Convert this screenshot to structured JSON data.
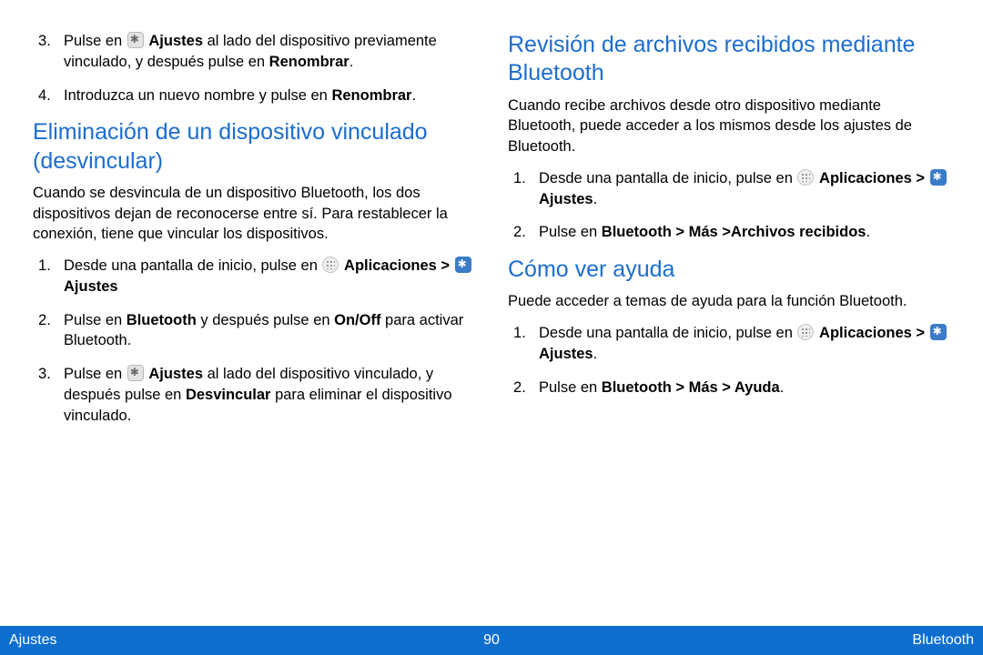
{
  "left": {
    "list1": {
      "item3": {
        "t1": "Pulse en ",
        "gear_alt": "icono-ajustes-gris",
        "t2": " ",
        "b1": "Ajustes",
        "t3": " al lado del dispositivo previamente vinculado, y después pulse en ",
        "b2": "Renombrar",
        "t4": "."
      },
      "item4": {
        "t1": "Introduzca un nuevo nombre y pulse en ",
        "b1": "Renombrar",
        "t2": "."
      }
    },
    "heading1": "Eliminación de un dispositivo vinculado (desvincular)",
    "para1": "Cuando se desvincula de un dispositivo Bluetooth, los dos dispositivos dejan de reconocerse entre sí. Para restablecer la conexión, tiene que vincular los dispositivos.",
    "list2": {
      "item1": {
        "t1": "Desde una pantalla de inicio, pulse en ",
        "apps_alt": "icono-aplicaciones",
        "t2": " ",
        "b1": "Aplicaciones > ",
        "gear_alt": "icono-ajustes",
        "t3": " ",
        "b2": "Ajustes"
      },
      "item2": {
        "t1": "Pulse en ",
        "b1": "Bluetooth",
        "t2": " y después pulse en ",
        "b2": "On/Off",
        "t3": " para activar Bluetooth."
      },
      "item3": {
        "t1": "Pulse en ",
        "gear_alt": "icono-ajustes-gris",
        "t2": " ",
        "b1": "Ajustes",
        "t3": " al lado del dispositivo vinculado, y después pulse en ",
        "b2": "Desvincular",
        "t4": " para eliminar el dispositivo vinculado."
      }
    }
  },
  "right": {
    "heading1": "Revisión de archivos recibidos mediante Bluetooth",
    "para1": "Cuando recibe archivos desde otro dispositivo mediante Bluetooth, puede acceder a los mismos desde los ajustes de Bluetooth.",
    "list1": {
      "item1": {
        "t1": "Desde una pantalla de inicio, pulse en ",
        "apps_alt": "icono-aplicaciones",
        "t2": " ",
        "b1": "Aplicaciones > ",
        "gear_alt": "icono-ajustes",
        "t3": " ",
        "b2": "Ajustes",
        "t4": "."
      },
      "item2": {
        "t1": "Pulse en ",
        "b1": "Bluetooth > Más >Archivos recibidos",
        "t2": "."
      }
    },
    "heading2": "Cómo ver ayuda",
    "para2": "Puede acceder a temas de ayuda para la función Bluetooth.",
    "list2": {
      "item1": {
        "t1": "Desde una pantalla de inicio, pulse en ",
        "apps_alt": "icono-aplicaciones",
        "t2": " ",
        "b1": "Aplicaciones > ",
        "gear_alt": "icono-ajustes",
        "t3": " ",
        "b2": "Ajustes",
        "t4": "."
      },
      "item2": {
        "t1": "Pulse en ",
        "b1": "Bluetooth > Más > Ayuda",
        "t2": "."
      }
    }
  },
  "footer": {
    "left": "Ajustes",
    "center": "90",
    "right": "Bluetooth"
  }
}
